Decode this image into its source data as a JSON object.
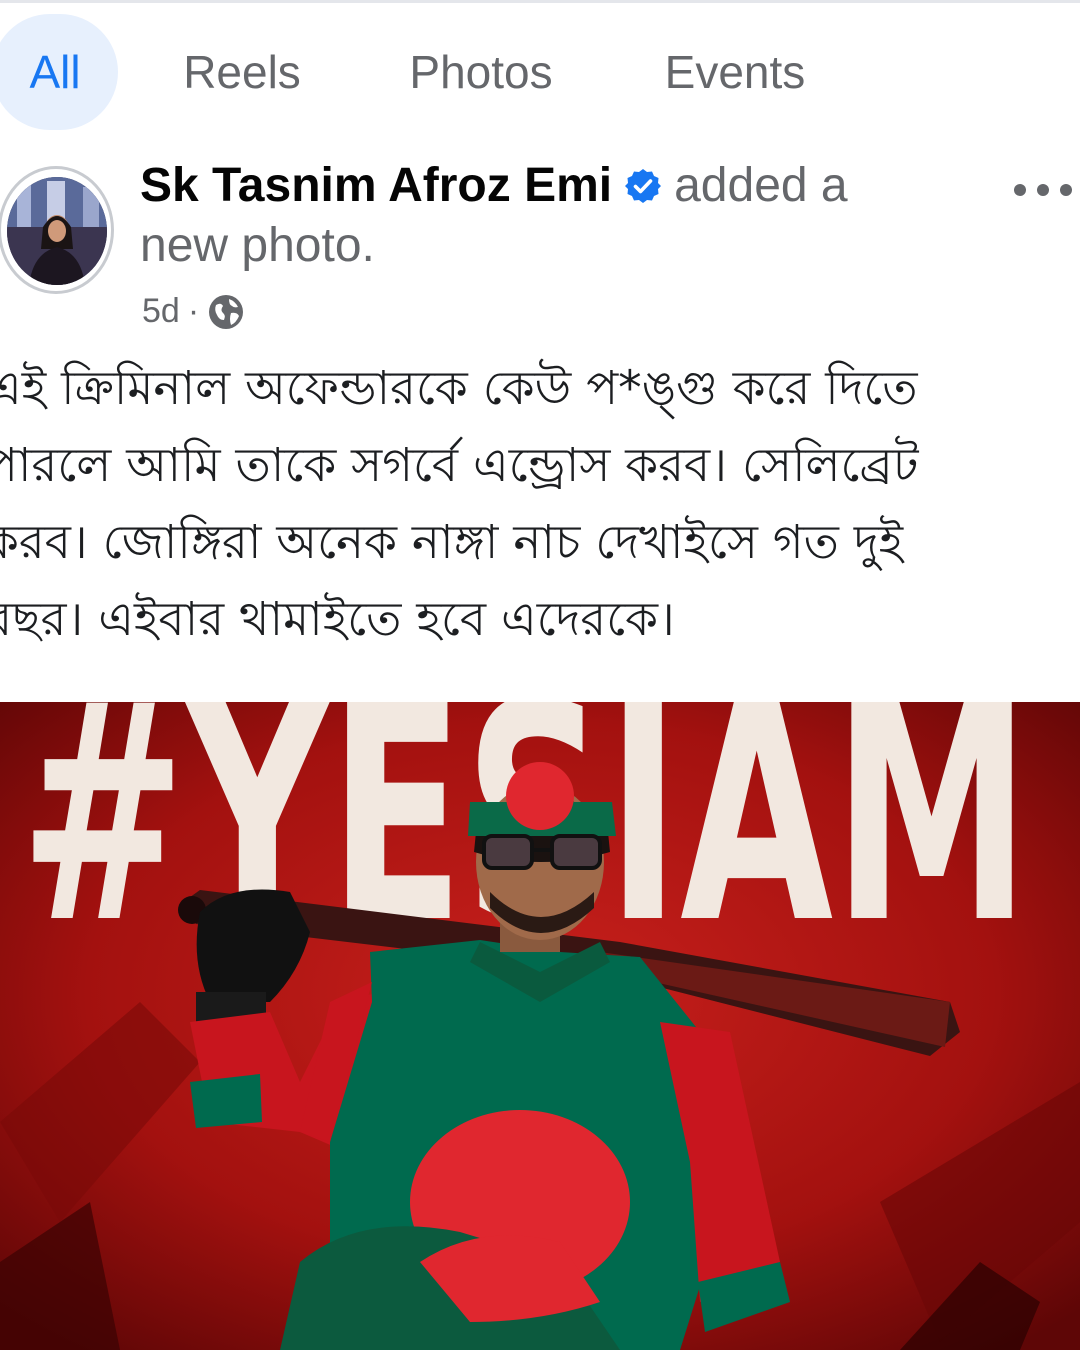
{
  "tabs": [
    {
      "label": "All",
      "active": true
    },
    {
      "label": "Reels",
      "active": false
    },
    {
      "label": "Photos",
      "active": false
    },
    {
      "label": "Events",
      "active": false
    }
  ],
  "post": {
    "author": "Sk Tasnim Afroz Emi",
    "verified": true,
    "action_line1": "added a",
    "action_line2": "new photo.",
    "time": "5d",
    "separator": "·",
    "audience_icon": "globe-icon",
    "more_icon": "more-options-icon",
    "caption": "এই ক্রিমিনাল অফেন্ডারকে কেউ প*ঙ্গু করে দিতে\nপারলে আমি তাকে সগর্বে এন্ড্রোস করব। সেলিব্রেট\nকরব। জোঙ্গিরা অনেক নাঙ্গা নাচ দেখাইসে গত দুই\nবছর। এইবার থামাইতে হবে এদেরকে।",
    "photo": {
      "hashtag_text": "#YESIAM",
      "description": "man with flag headband holding bat"
    }
  },
  "colors": {
    "accent": "#1877f2",
    "active_tab_bg": "#e7f0fd",
    "muted_text": "#65676b",
    "flag_green": "#006a4e",
    "flag_red": "#e0272f"
  }
}
